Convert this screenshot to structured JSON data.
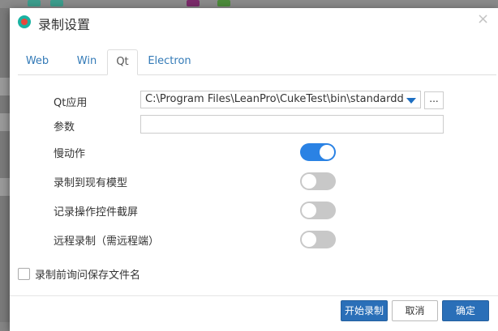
{
  "dialog": {
    "title": "录制设置",
    "close_glyph": "×",
    "tabs": [
      {
        "label": "Web"
      },
      {
        "label": "Win"
      },
      {
        "label": "Qt",
        "active": true
      },
      {
        "label": "Electron"
      }
    ],
    "qt_app": {
      "label": "Qt应用",
      "value": "C:\\Program Files\\LeanPro\\CukeTest\\bin\\standarddi",
      "browse_label": "..."
    },
    "args": {
      "label": "参数",
      "value": ""
    },
    "options": [
      {
        "label": "慢动作",
        "on": true
      },
      {
        "label": "录制到现有模型",
        "on": false
      },
      {
        "label": "记录操作控件截屏",
        "on": false
      },
      {
        "label": "远程录制（需远程端）",
        "on": false
      }
    ],
    "ask_filename": {
      "label": "录制前询问保存文件名",
      "checked": false
    },
    "buttons": {
      "start": "开始录制",
      "cancel": "取消",
      "ok": "确定"
    }
  },
  "colors": {
    "accent": "#2a6fb8",
    "toggle_on": "#2a82e4",
    "toggle_off": "#c8c8c8",
    "link": "#337ab7"
  },
  "icons": [
    "app-logo-icon",
    "close-icon",
    "dropdown-arrow-icon"
  ]
}
